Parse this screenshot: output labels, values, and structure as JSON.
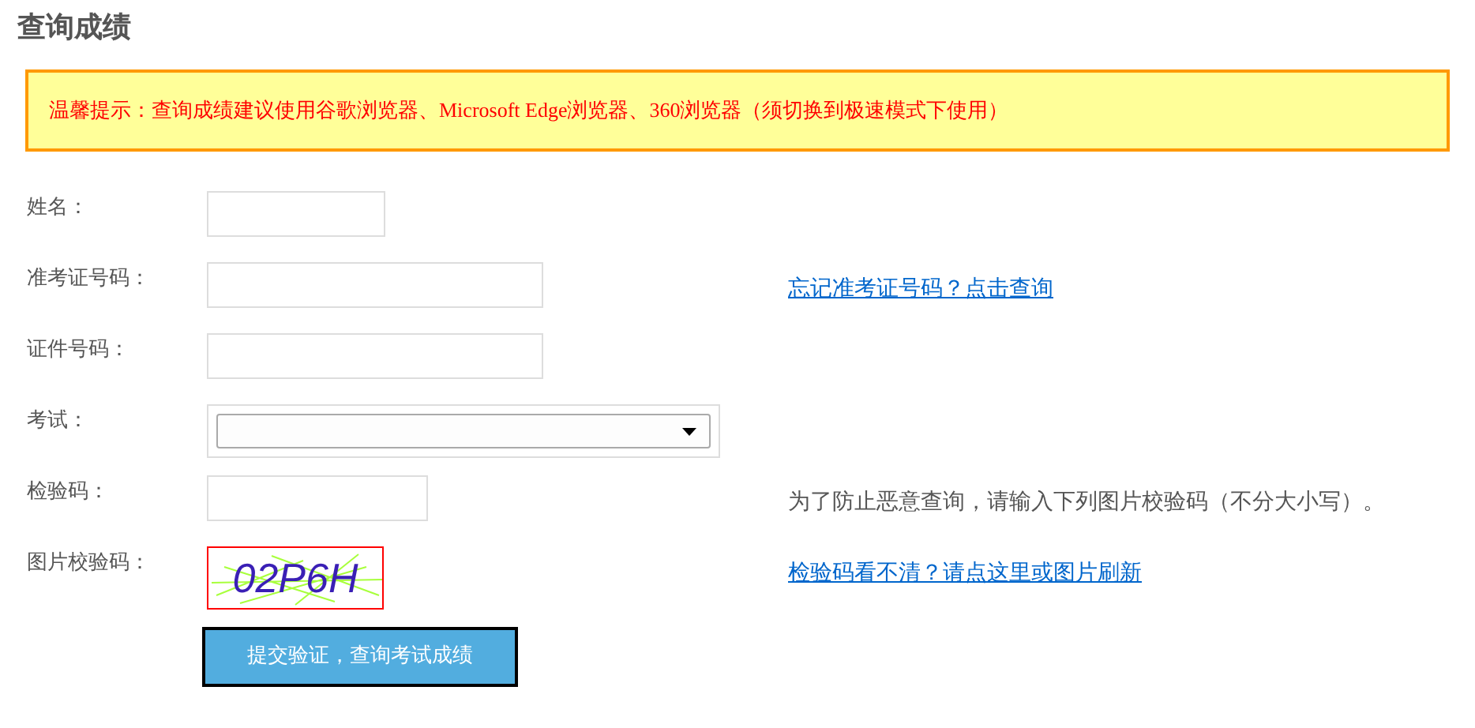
{
  "page_title": "查询成绩",
  "notice": "温馨提示：查询成绩建议使用谷歌浏览器、Microsoft Edge浏览器、360浏览器（须切换到极速模式下使用）",
  "rows": [
    {
      "label": "姓名：",
      "kind": "short"
    },
    {
      "label": "准考证号码：",
      "kind": "long",
      "aside": {
        "kind": "link",
        "text": "忘记准考证号码？点击查询"
      }
    },
    {
      "label": "证件号码：",
      "kind": "long"
    },
    {
      "label": "考试：",
      "kind": "select"
    },
    {
      "label": "检验码：",
      "kind": "medium",
      "aside": {
        "kind": "hint",
        "text": "为了防止恶意查询，请输入下列图片校验码（不分大小写）。"
      }
    },
    {
      "label": "图片校验码：",
      "kind": "captcha",
      "captcha_text": "02P6H",
      "aside": {
        "kind": "link",
        "text": "检验码看不清？请点这里或图片刷新"
      }
    }
  ],
  "submit_button": "提交验证，查询考试成绩"
}
